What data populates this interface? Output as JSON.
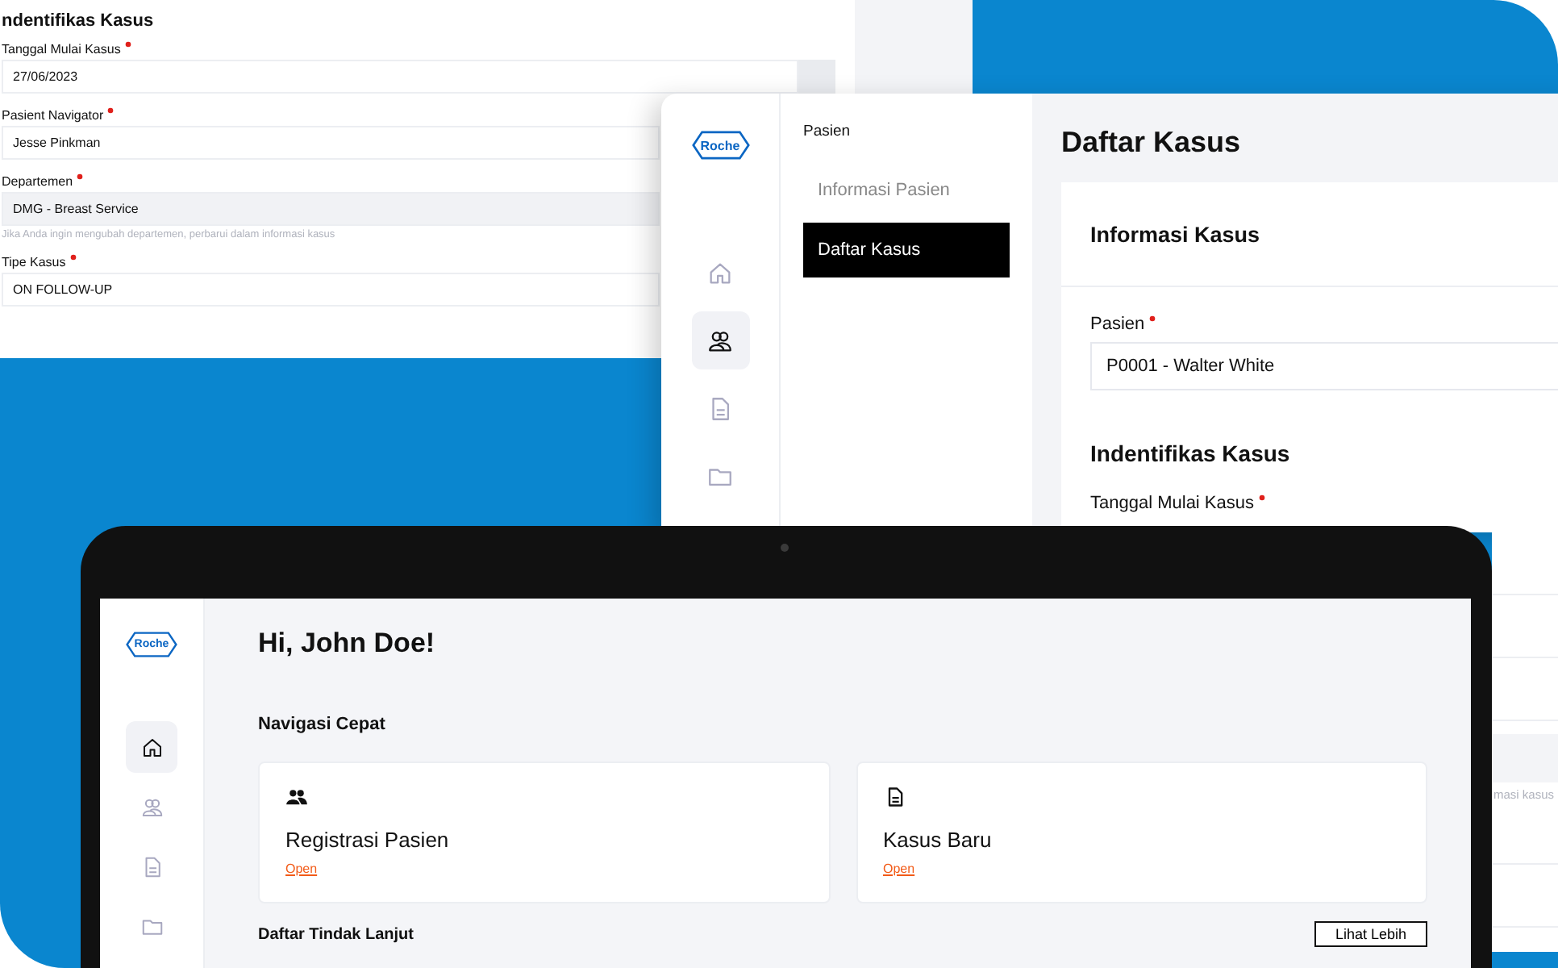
{
  "form_panel": {
    "title": "ndentifikas Kasus",
    "fields": [
      {
        "label": "Tanggal Mulai Kasus",
        "required": true,
        "value": "27/06/2023",
        "disabled": false,
        "kind": "date"
      },
      {
        "label": "Pasient Navigator",
        "required": true,
        "value": "Jesse Pinkman",
        "disabled": false,
        "kind": "text"
      },
      {
        "label": "Departemen",
        "required": true,
        "value": "DMG - Breast Service",
        "disabled": true,
        "hint": "Jika Anda ingin mengubah departemen, perbarui dalam informasi kasus",
        "kind": "text"
      },
      {
        "label": "Tipe Kasus",
        "required": true,
        "value": "ON FOLLOW-UP",
        "disabled": false,
        "kind": "text"
      }
    ]
  },
  "case_window": {
    "logo": "Roche",
    "rail": [
      {
        "kind": "home",
        "selected": false
      },
      {
        "kind": "people",
        "selected": true
      },
      {
        "kind": "document",
        "selected": false
      },
      {
        "kind": "folder",
        "selected": false
      }
    ],
    "subnav_heading": "Pasien",
    "subnav": [
      {
        "label": "Informasi Pasien",
        "selected": false
      },
      {
        "label": "Daftar Kasus",
        "selected": true
      }
    ],
    "title": "Daftar Kasus",
    "card_title": "Informasi Kasus",
    "patient_field": {
      "label": "Pasien",
      "required": true,
      "value": "P0001 - Walter White"
    },
    "section_title": "Indentifikas Kasus",
    "next_field": {
      "label": "Tanggal Mulai Kasus",
      "required": true
    }
  },
  "side_panel": {
    "hint": "masi kasus"
  },
  "tablet": {
    "logo": "Roche",
    "rail": [
      {
        "kind": "home",
        "selected": true
      },
      {
        "kind": "people",
        "selected": false
      },
      {
        "kind": "document",
        "selected": false
      },
      {
        "kind": "folder",
        "selected": false
      }
    ],
    "greeting": "Hi, John Doe!",
    "quick_nav_title": "Navigasi Cepat",
    "quick_nav": [
      {
        "kind": "people-filled",
        "title": "Registrasi Pasien",
        "link": "Open"
      },
      {
        "kind": "document",
        "title": "Kasus Baru",
        "link": "Open"
      }
    ],
    "followup_title": "Daftar Tindak Lanjut",
    "see_more": "Lihat Lebih"
  }
}
